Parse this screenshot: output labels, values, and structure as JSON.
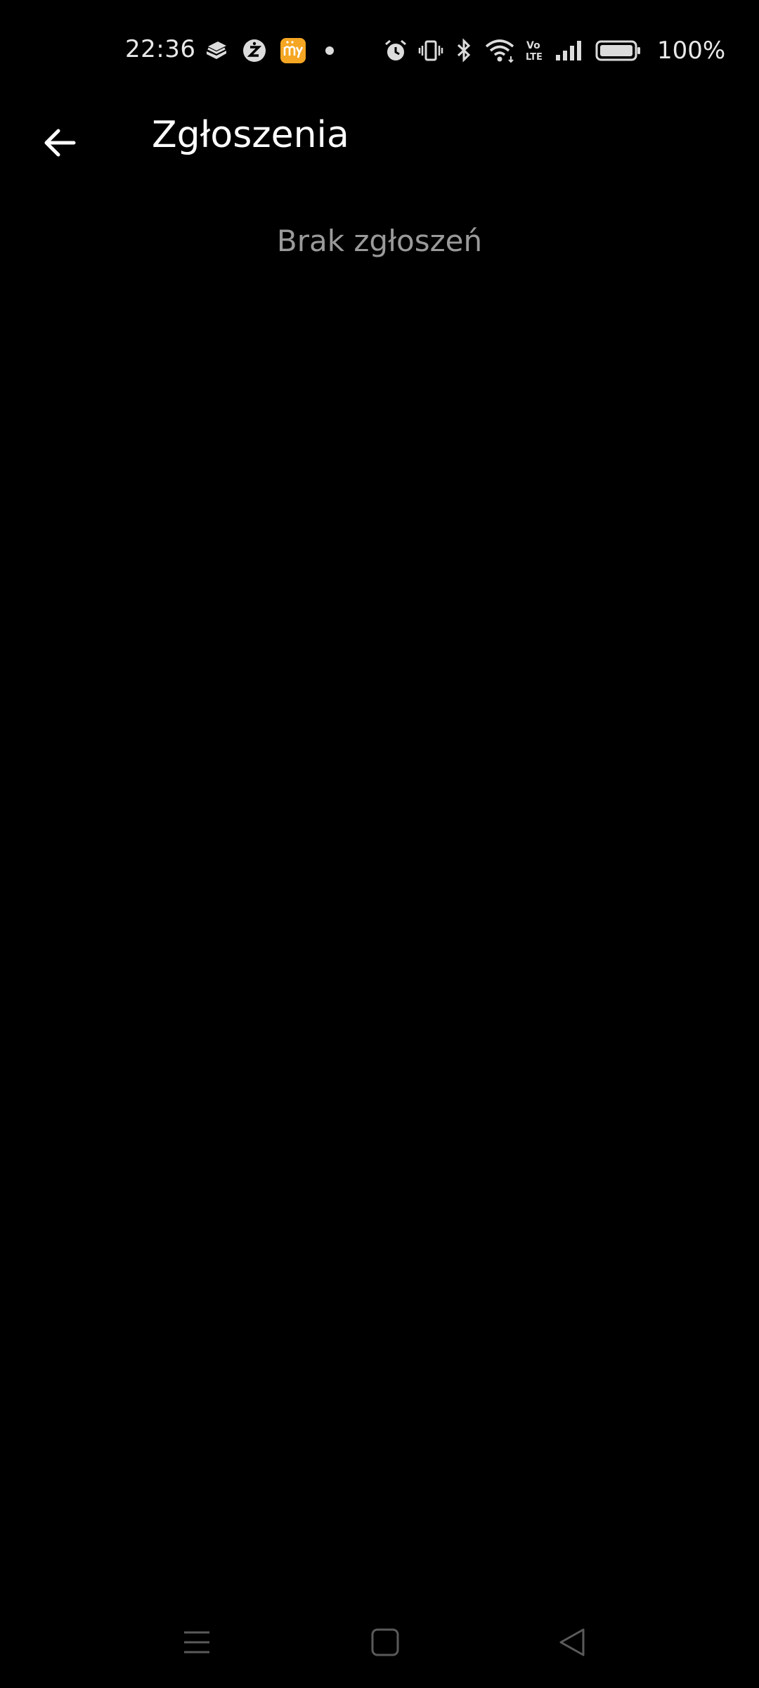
{
  "status_bar": {
    "time": "22:36",
    "battery_percent": "100%",
    "notification_icons": [
      "layers-app-icon",
      "zabka-app-icon",
      "my-app-icon",
      "more-notifications-dot-icon"
    ],
    "system_icons": [
      "alarm-icon",
      "vibrate-icon",
      "bluetooth-icon",
      "wifi-icon",
      "volte-icon",
      "signal-icon",
      "battery-icon"
    ],
    "my_app_badge_color": "#f5a623",
    "battery_level": 1.0
  },
  "app_bar": {
    "title": "Zgłoszenia",
    "back_icon": "arrow-left-icon"
  },
  "content": {
    "empty_message": "Brak zgłoszeń"
  },
  "nav_bar": {
    "icons": [
      "recents-menu-icon",
      "home-square-icon",
      "back-triangle-icon"
    ]
  },
  "colors": {
    "background": "#000000",
    "title": "#ffffff",
    "empty_text": "#9a9a9a",
    "nav_icon": "#5a5a5a"
  }
}
